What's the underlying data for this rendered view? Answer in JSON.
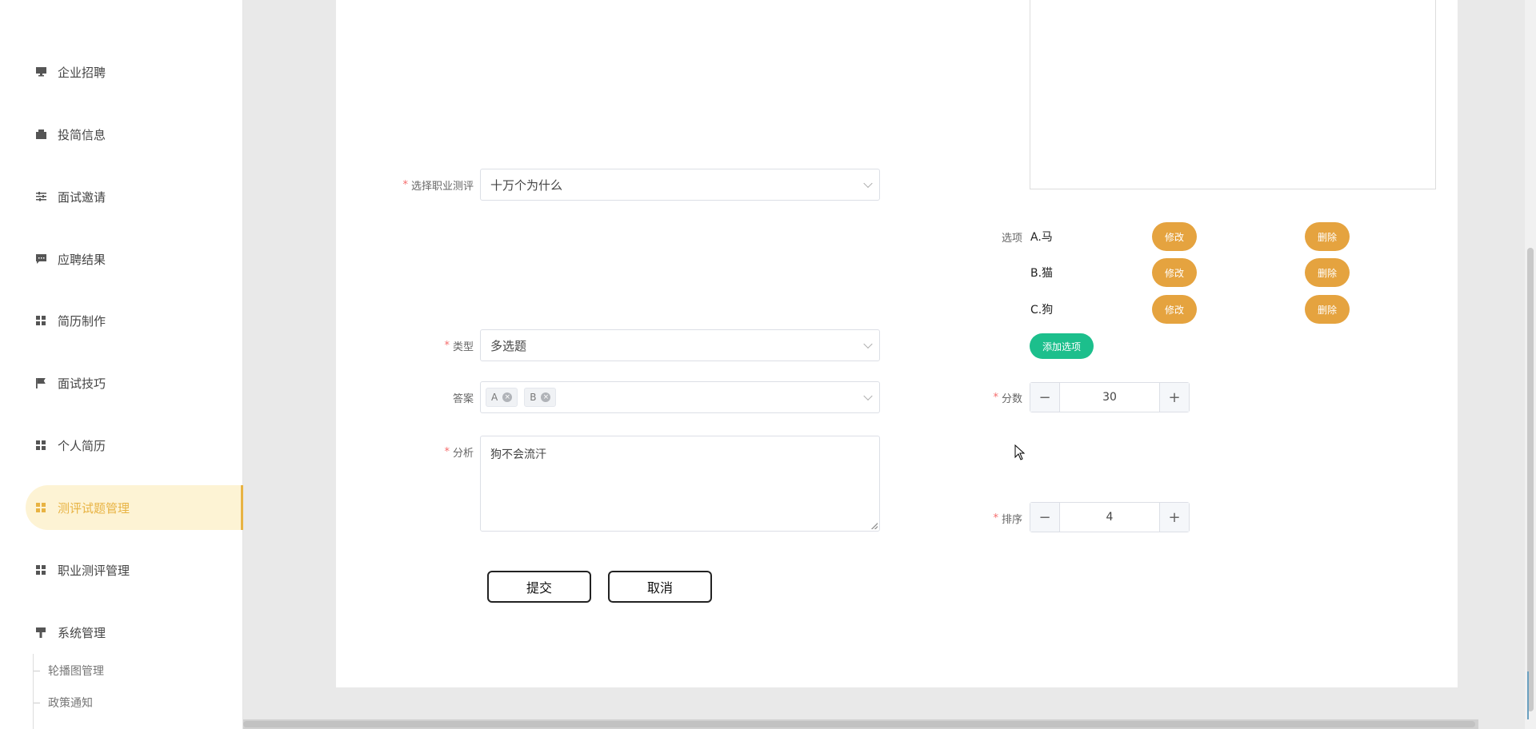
{
  "sidebar": {
    "items": [
      {
        "label": "企业招聘",
        "icon": "monitor-icon"
      },
      {
        "label": "投简信息",
        "icon": "wallet-icon"
      },
      {
        "label": "面试邀请",
        "icon": "sliders-icon"
      },
      {
        "label": "应聘结果",
        "icon": "chat-icon"
      },
      {
        "label": "简历制作",
        "icon": "grid-icon"
      },
      {
        "label": "面试技巧",
        "icon": "flag-icon"
      },
      {
        "label": "个人简历",
        "icon": "grid-icon"
      },
      {
        "label": "测评试题管理",
        "icon": "grid-icon"
      },
      {
        "label": "职业测评管理",
        "icon": "grid-icon"
      },
      {
        "label": "系统管理",
        "icon": "brush-icon"
      }
    ],
    "active_index": 7,
    "sub_items": [
      {
        "label": "轮播图管理"
      },
      {
        "label": "政策通知"
      }
    ],
    "accent_color": "#e8b343"
  },
  "form": {
    "assessment": {
      "label": "选择职业测评",
      "value": "十万个为什么"
    },
    "type": {
      "label": "类型",
      "value": "多选题"
    },
    "answer": {
      "label": "答案",
      "tags": [
        "A",
        "B"
      ]
    },
    "analysis": {
      "label": "分析",
      "value": "狗不会流汗"
    },
    "options": {
      "label": "选项",
      "items": [
        {
          "text": "A.马"
        },
        {
          "text": "B.猫"
        },
        {
          "text": "C.狗"
        }
      ],
      "edit_label": "修改",
      "delete_label": "删除",
      "add_label": "添加选项"
    },
    "score": {
      "label": "分数",
      "value": "30"
    },
    "order": {
      "label": "排序",
      "value": "4"
    },
    "submit_label": "提交",
    "cancel_label": "取消",
    "pill_color": "#e5a33f",
    "add_color": "#1cbf8c",
    "required_color": "#f56c6c"
  }
}
